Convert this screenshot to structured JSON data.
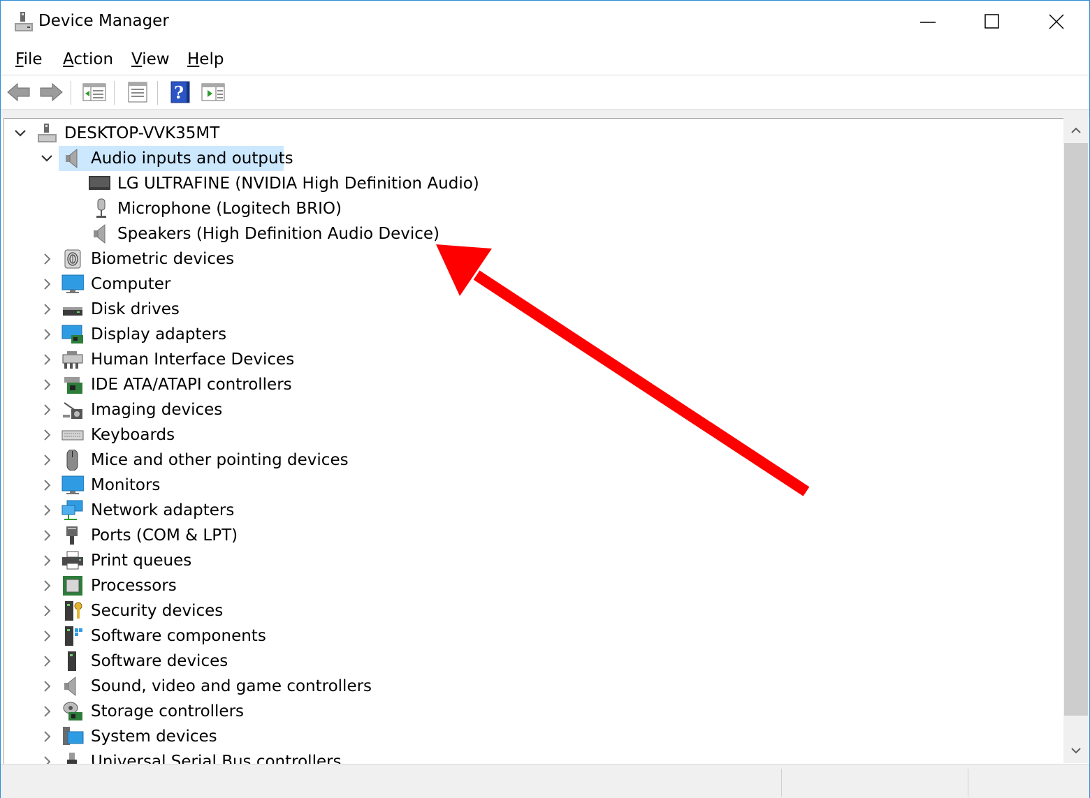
{
  "window": {
    "title": "Device Manager",
    "controls": {
      "minimize": "minimize-icon",
      "maximize": "maximize-icon",
      "close": "close-icon"
    }
  },
  "menu": [
    {
      "accel": "F",
      "rest": "ile"
    },
    {
      "accel": "A",
      "rest": "ction"
    },
    {
      "accel": "V",
      "rest": "iew"
    },
    {
      "accel": "H",
      "rest": "elp"
    }
  ],
  "toolbar": {
    "icons": [
      "back-arrow-icon",
      "forward-arrow-icon",
      "show-hide-console-tree-icon",
      "properties-icon",
      "help-icon",
      "show-action-pane-icon"
    ]
  },
  "tree": {
    "root": "DESKTOP-VVK35MT",
    "expanded_category": "Audio inputs and outputs",
    "children": [
      "LG ULTRAFINE (NVIDIA High Definition Audio)",
      "Microphone (Logitech BRIO)",
      "Speakers (High Definition Audio Device)"
    ],
    "categories": [
      "Biometric devices",
      "Computer",
      "Disk drives",
      "Display adapters",
      "Human Interface Devices",
      "IDE ATA/ATAPI controllers",
      "Imaging devices",
      "Keyboards",
      "Mice and other pointing devices",
      "Monitors",
      "Network adapters",
      "Ports (COM & LPT)",
      "Print queues",
      "Processors",
      "Security devices",
      "Software components",
      "Software devices",
      "Sound, video and game controllers",
      "Storage controllers",
      "System devices",
      "Universal Serial Bus controllers"
    ]
  },
  "colors": {
    "selection": "#cce8ff",
    "window_border": "#2b8cd6",
    "annotation_arrow": "#ff0000"
  }
}
